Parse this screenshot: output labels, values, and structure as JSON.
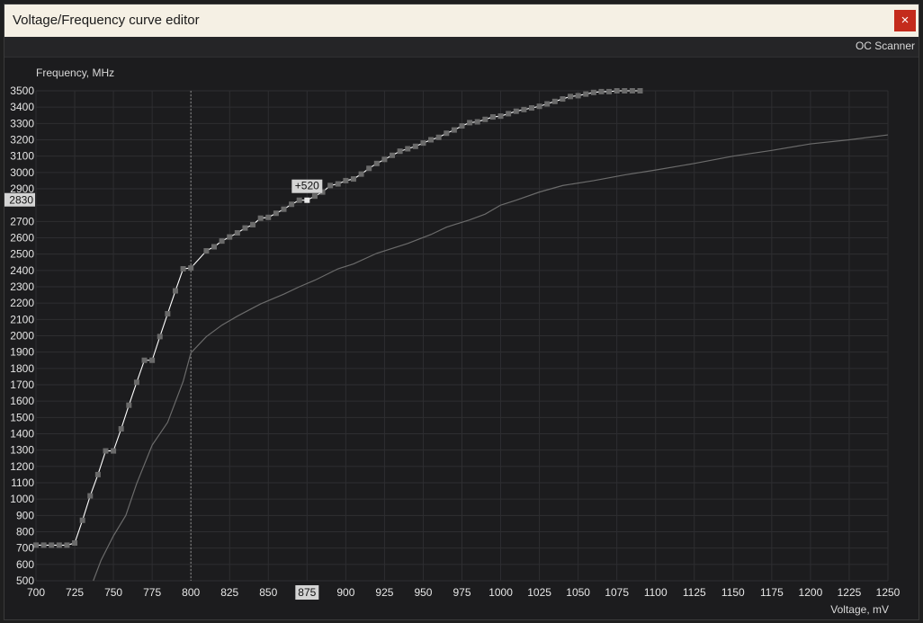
{
  "window": {
    "title": "Voltage/Frequency curve editor",
    "close_label": "×",
    "toolbar_button": "OC Scanner"
  },
  "colors": {
    "background": "#1c1c1e",
    "grid": "#2e2e31",
    "curve": "#ffffff",
    "point": "#6a6a6a",
    "default_curve": "#6b6b6b",
    "close_button": "#c42b1c"
  },
  "chart_data": {
    "type": "line",
    "ylabel": "Frequency, MHz",
    "xlabel": "Voltage, mV",
    "xlim": [
      700,
      1250
    ],
    "ylim": [
      500,
      3500
    ],
    "x_ticks": [
      700,
      725,
      750,
      775,
      800,
      825,
      850,
      875,
      900,
      925,
      950,
      975,
      1000,
      1025,
      1050,
      1075,
      1100,
      1125,
      1150,
      1175,
      1200,
      1225,
      1250
    ],
    "y_ticks": [
      500,
      600,
      700,
      800,
      900,
      1000,
      1100,
      1200,
      1300,
      1400,
      1500,
      1600,
      1700,
      1800,
      1900,
      2000,
      2100,
      2200,
      2300,
      2400,
      2500,
      2600,
      2700,
      2800,
      2900,
      3000,
      3100,
      3200,
      3300,
      3400,
      3500
    ],
    "grid": true,
    "highlight": {
      "x": 875,
      "x_label": "875",
      "y": 2830,
      "y_label": "2830",
      "offset_label": "+520"
    },
    "reference_x": 800,
    "series": [
      {
        "role": "edited",
        "x": [
          700,
          705,
          710,
          715,
          720,
          725,
          730,
          735,
          740,
          745,
          750,
          755,
          760,
          765,
          770,
          775,
          780,
          785,
          790,
          795,
          800,
          810,
          815,
          820,
          825,
          830,
          835,
          840,
          845,
          850,
          855,
          860,
          865,
          870,
          875,
          880,
          885,
          890,
          895,
          900,
          905,
          910,
          915,
          920,
          925,
          930,
          935,
          940,
          945,
          950,
          955,
          960,
          965,
          970,
          975,
          980,
          985,
          990,
          995,
          1000,
          1005,
          1010,
          1015,
          1020,
          1025,
          1030,
          1035,
          1040,
          1045,
          1050,
          1055,
          1060,
          1065,
          1070,
          1075,
          1080,
          1085,
          1090
        ],
        "y": [
          718,
          718,
          718,
          718,
          718,
          731,
          870,
          1020,
          1150,
          1295,
          1295,
          1430,
          1575,
          1715,
          1850,
          1850,
          1995,
          2135,
          2275,
          2410,
          2415,
          2520,
          2545,
          2580,
          2605,
          2630,
          2660,
          2680,
          2720,
          2725,
          2750,
          2775,
          2805,
          2830,
          2830,
          2855,
          2880,
          2920,
          2930,
          2950,
          2960,
          2990,
          3025,
          3055,
          3080,
          3105,
          3130,
          3145,
          3160,
          3180,
          3200,
          3215,
          3240,
          3260,
          3285,
          3305,
          3310,
          3325,
          3340,
          3345,
          3360,
          3375,
          3385,
          3395,
          3405,
          3420,
          3435,
          3450,
          3465,
          3470,
          3480,
          3490,
          3495,
          3495,
          3500,
          3500,
          3500,
          3500
        ]
      },
      {
        "role": "default",
        "x": [
          737,
          742,
          750,
          758,
          765,
          775,
          785,
          795,
          800,
          810,
          820,
          830,
          845,
          860,
          870,
          880,
          895,
          905,
          920,
          940,
          955,
          965,
          980,
          990,
          1000,
          1010,
          1025,
          1040,
          1060,
          1080,
          1100,
          1125,
          1150,
          1175,
          1200,
          1225,
          1250
        ],
        "y": [
          500,
          625,
          775,
          900,
          1095,
          1330,
          1470,
          1720,
          1895,
          1995,
          2065,
          2120,
          2195,
          2255,
          2300,
          2340,
          2410,
          2440,
          2505,
          2565,
          2620,
          2665,
          2710,
          2745,
          2800,
          2830,
          2880,
          2920,
          2950,
          2985,
          3015,
          3055,
          3100,
          3135,
          3175,
          3200,
          3230
        ]
      }
    ]
  }
}
